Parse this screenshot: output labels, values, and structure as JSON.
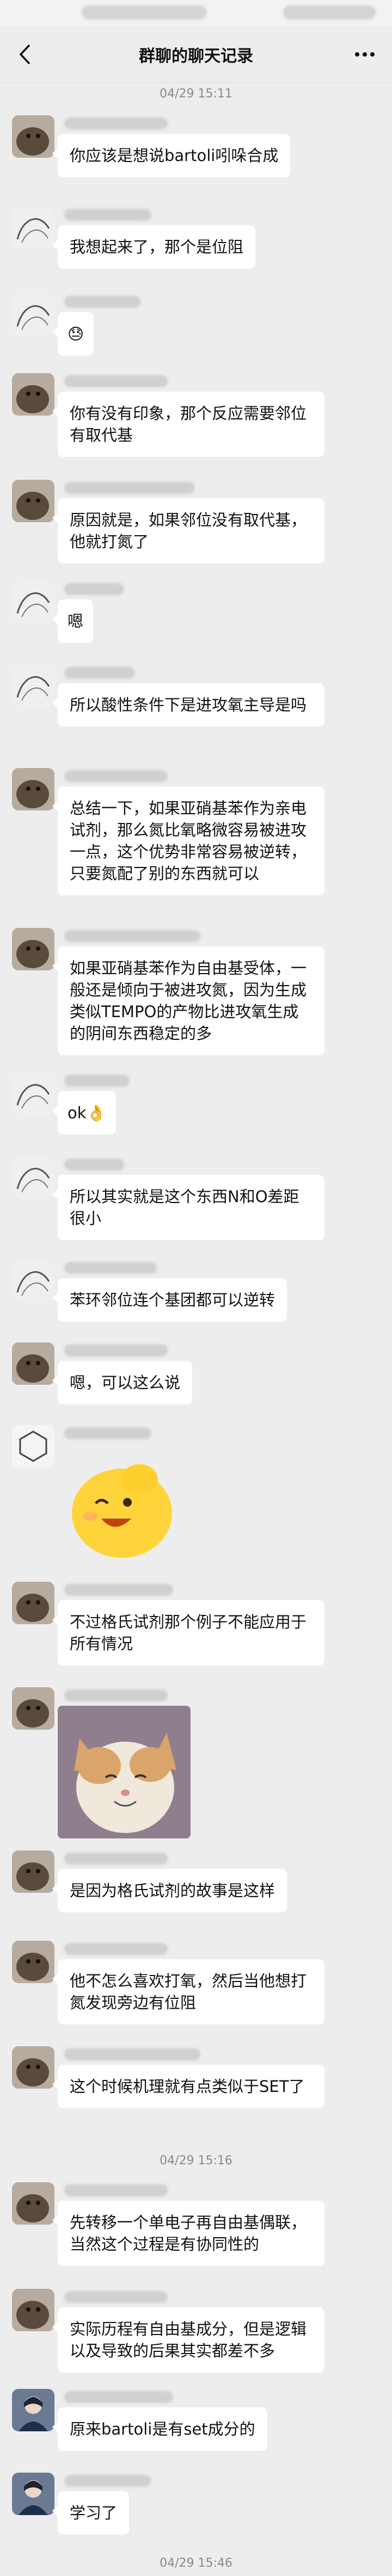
{
  "header": {
    "title": "群聊的聊天记录",
    "back_icon": "chevron-left-icon",
    "more_icon": "more-dots-icon"
  },
  "timestamps": [
    "04/29 15:11",
    "04/29 15:16",
    "04/29 15:46"
  ],
  "messages": [
    {
      "text": "你应该是想说bartoli吲哚合成"
    },
    {
      "text": "我想起来了，那个是位阻"
    },
    {
      "text": "😓"
    },
    {
      "text": "你有没有印象，那个反应需要邻位有取代基"
    },
    {
      "text": "原因就是，如果邻位没有取代基，他就打氮了"
    },
    {
      "text": "嗯"
    },
    {
      "text": "所以酸性条件下是进攻氧主导是吗"
    },
    {
      "text": "总结一下，如果亚硝基苯作为亲电试剂，那么氮比氧略微容易被进攻一点，这个优势非常容易被逆转，只要氮配了别的东西就可以"
    },
    {
      "text": "如果亚硝基苯作为自由基受体，一般还是倾向于被进攻氮，因为生成类似TEMPO的产物比进攻氧生成的阴间东西稳定的多"
    },
    {
      "text": "ok👌"
    },
    {
      "text": "所以其实就是这个东西N和O差距很小"
    },
    {
      "text": "苯环邻位连个基团都可以逆转"
    },
    {
      "text": "嗯，可以这么说"
    },
    {
      "text": "不过格氏试剂那个例子不能应用于所有情况"
    },
    {
      "text": "是因为格氏试剂的故事是这样"
    },
    {
      "text": "他不怎么喜欢打氧，然后当他想打氮发现旁边有位阻"
    },
    {
      "text": "这个时候机理就有点类似于SET了"
    },
    {
      "text": "先转移一个单电子再自由基偶联，当然这个过程是有协同性的"
    },
    {
      "text": "实际历程有自由基成分，但是逻辑以及导致的后果其实都差不多"
    },
    {
      "text": "原来bartoli是有set成分的"
    },
    {
      "text": "学习了"
    }
  ],
  "stickers": [
    {
      "name": "yellow-blob-sticker"
    },
    {
      "name": "cat-photo-sticker"
    }
  ],
  "colors": {
    "background": "#ededed",
    "bubble": "#ffffff",
    "timestamp": "#8a8a8a"
  }
}
